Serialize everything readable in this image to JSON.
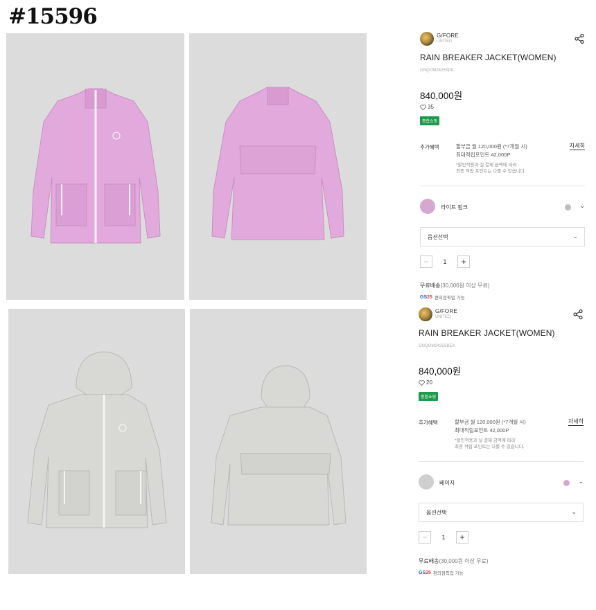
{
  "post_id": "#15596",
  "products": [
    {
      "brand_name": "G/FORE",
      "brand_sub": "UNITED",
      "title": "RAIN BREAKER JACKET(WOMEN)",
      "code": "GNQOM2425SPIL",
      "price": "840,000원",
      "likes": "35",
      "badge": "종합쇼핑",
      "benefit_label": "추가혜택",
      "benefit_line1": "할부금 월 120,000원 (*7개월 시)",
      "benefit_line2": "최대적립포인트 42,000P",
      "benefit_note1": "*할인적용과 실 결제 금액에 따라",
      "benefit_note2": "최종 적립 포인트는 다를 수 있습니다.",
      "detail_link": "자세히",
      "color_name": "라이트 핑크",
      "color_hex": "#d7a8cf",
      "alt_color_hex": "#bdbdbd",
      "option_placeholder": "옵션선택",
      "quantity": "1",
      "shipping_free": "무료배송",
      "shipping_condition": "(30,000원 이상 무료)",
      "convenience_text": "편의점픽업 가능"
    },
    {
      "brand_name": "G/FORE",
      "brand_sub": "UNITED",
      "title": "RAIN BREAKER JACKET(WOMEN)",
      "code": "GNQOM2425SBEX",
      "price": "840,000원",
      "likes": "20",
      "badge": "종합쇼핑",
      "benefit_label": "추가혜택",
      "benefit_line1": "할부금 월 120,000원 (*7개월 시)",
      "benefit_line2": "최대적립포인트 42,000P",
      "benefit_note1": "*할인적용과 실 결제 금액에 따라",
      "benefit_note2": "최종 적립 포인트는 다를 수 있습니다.",
      "detail_link": "자세히",
      "color_name": "베이지",
      "color_hex": "#cfcfcf",
      "alt_color_hex": "#d7a8cf",
      "option_placeholder": "옵션선택",
      "quantity": "1",
      "shipping_free": "무료배송",
      "shipping_condition": "(30,000원 이상 무료)",
      "convenience_text": "편의점픽업 가능"
    }
  ],
  "photos": [
    {
      "name": "pink-jacket-front",
      "color": "#e2a9dc"
    },
    {
      "name": "pink-jacket-back",
      "color": "#e2a9dc"
    },
    {
      "name": "grey-jacket-front",
      "color": "#d8d9d5"
    },
    {
      "name": "grey-jacket-back",
      "color": "#d8d9d5"
    }
  ],
  "icons": {
    "share": "share-icon",
    "heart": "heart-icon",
    "chevron": "chevron-down-icon",
    "gs25": "gs25-logo"
  }
}
